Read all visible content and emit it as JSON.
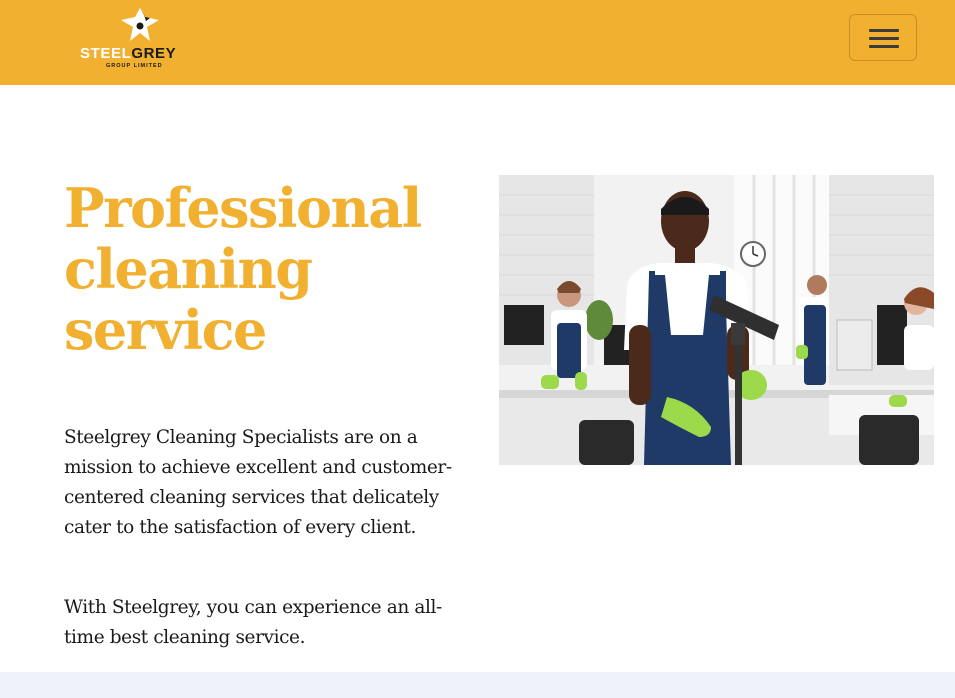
{
  "brand": {
    "logo_primary": "STEEL",
    "logo_secondary": "GREY",
    "logo_sub": "GROUP LIMITED",
    "accent_color": "#f1b02f"
  },
  "navbar": {
    "toggle_icon": "hamburger-menu-icon"
  },
  "hero": {
    "title_line_1": "Professional",
    "title_line_2": "cleaning",
    "title_line_3": "service",
    "paragraph_1": "Steelgrey Cleaning Specialists are on a mission to achieve excellent and customer-centered cleaning services that delicately cater to the satisfaction of every client.",
    "paragraph_2": "With Steelgrey, you can experience an all-time best cleaning service."
  },
  "colors": {
    "navbar_bg": "#f1b02f",
    "title_color": "#f1b02f",
    "text_color": "#1a1a1a",
    "footer_band": "#eff2fb"
  }
}
